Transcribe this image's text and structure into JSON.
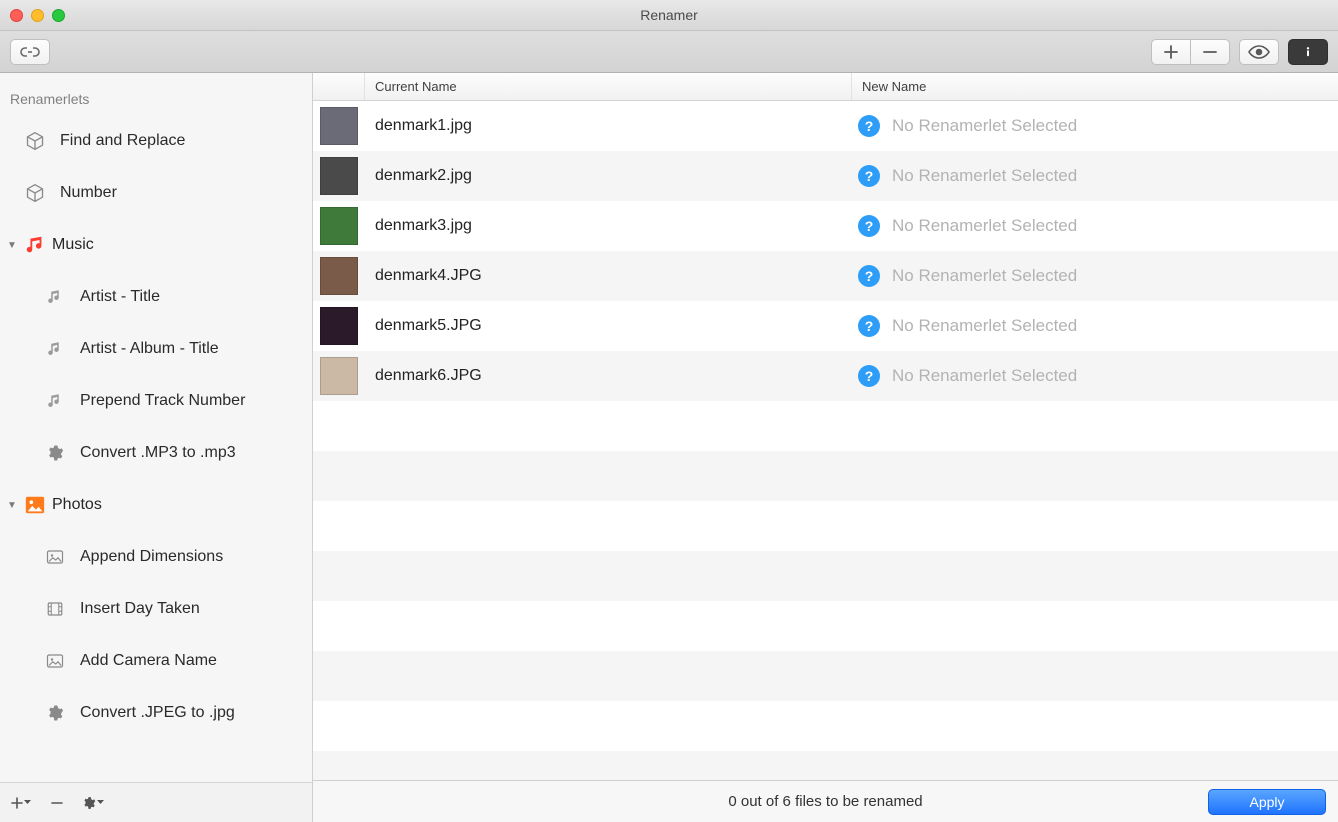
{
  "window": {
    "title": "Renamer"
  },
  "toolbar": {
    "link": "link-icon",
    "add": "plus-icon",
    "remove": "minus-icon",
    "preview": "eye-icon",
    "info": "info-icon"
  },
  "sidebar": {
    "header": "Renamerlets",
    "items": [
      {
        "type": "item",
        "icon": "cube",
        "label": "Find and Replace"
      },
      {
        "type": "item",
        "icon": "cube",
        "label": "Number"
      },
      {
        "type": "group",
        "icon": "music",
        "label": "Music",
        "expanded": true
      },
      {
        "type": "child",
        "icon": "note",
        "label": "Artist - Title"
      },
      {
        "type": "child",
        "icon": "note",
        "label": "Artist - Album - Title"
      },
      {
        "type": "child",
        "icon": "note",
        "label": "Prepend Track Number"
      },
      {
        "type": "child",
        "icon": "gear",
        "label": "Convert .MP3 to .mp3"
      },
      {
        "type": "group",
        "icon": "photo",
        "label": "Photos",
        "expanded": true
      },
      {
        "type": "child",
        "icon": "image",
        "label": "Append Dimensions"
      },
      {
        "type": "child",
        "icon": "film",
        "label": "Insert Day Taken"
      },
      {
        "type": "child",
        "icon": "image",
        "label": "Add Camera Name"
      },
      {
        "type": "child",
        "icon": "gear",
        "label": "Convert .JPEG to .jpg"
      }
    ],
    "footer": {
      "add": "+",
      "remove": "−",
      "action": "gear"
    }
  },
  "table": {
    "columns": {
      "current": "Current Name",
      "new": "New Name"
    },
    "placeholder": "No Renamerlet Selected",
    "rows": [
      {
        "current": "denmark1.jpg",
        "thumb": "#6b6b78"
      },
      {
        "current": "denmark2.jpg",
        "thumb": "#4a4a4a"
      },
      {
        "current": "denmark3.jpg",
        "thumb": "#3f7a3b"
      },
      {
        "current": "denmark4.JPG",
        "thumb": "#7a5a48"
      },
      {
        "current": "denmark5.JPG",
        "thumb": "#2a1a2a"
      },
      {
        "current": "denmark6.JPG",
        "thumb": "#cbb9a6"
      }
    ]
  },
  "status": {
    "text": "0 out of 6 files to be renamed",
    "apply": "Apply"
  }
}
